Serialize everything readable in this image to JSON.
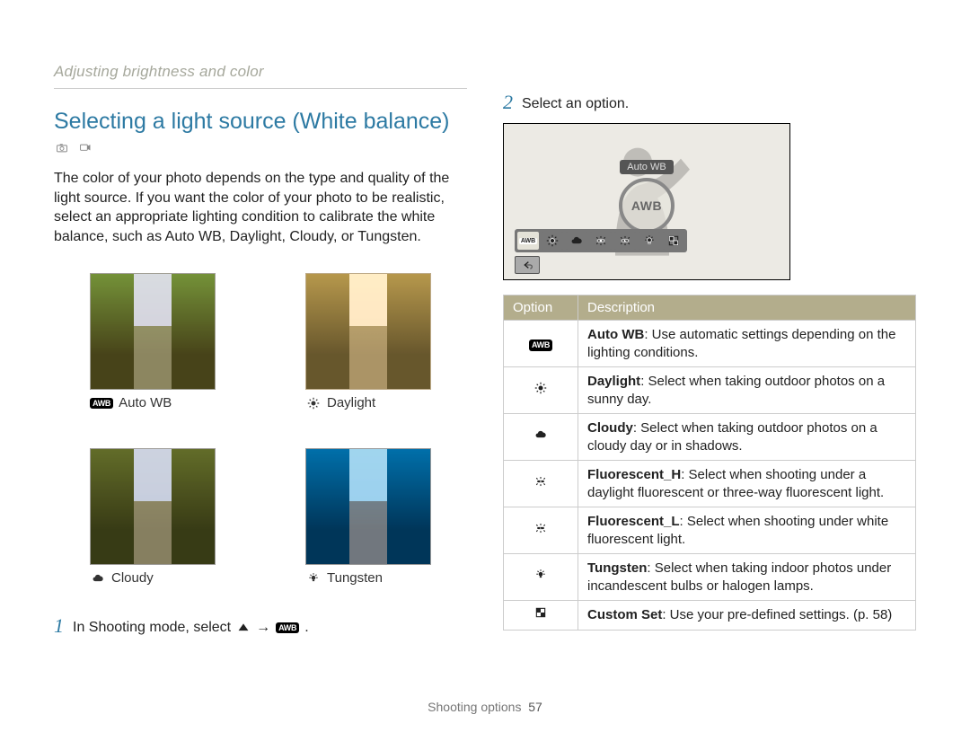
{
  "breadcrumb": "Adjusting brightness and color",
  "heading": "Selecting a light source (White balance)",
  "intro": "The color of your photo depends on the type and quality of the light source. If you want the color of your photo to be realistic, select an appropriate lighting condition to calibrate the white balance, such as Auto WB, Daylight, Cloudy, or Tungsten.",
  "samples": {
    "auto_wb": "Auto WB",
    "daylight": "Daylight",
    "cloudy": "Cloudy",
    "tungsten": "Tungsten"
  },
  "steps": {
    "s1_num": "1",
    "s1_a": "In Shooting mode, select",
    "s1_b": "→",
    "s1_c": ".",
    "s2_num": "2",
    "s2": "Select an option."
  },
  "screen": {
    "label": "Auto WB",
    "ring": "AWB",
    "icons": [
      "awb",
      "daylight",
      "cloudy",
      "fluor_h",
      "fluor_l",
      "tungsten",
      "custom"
    ]
  },
  "table": {
    "h_option": "Option",
    "h_desc": "Description",
    "rows": [
      {
        "icon": "awb",
        "name": "Auto WB",
        "desc": ": Use automatic settings depending on the lighting conditions."
      },
      {
        "icon": "daylight",
        "name": "Daylight",
        "desc": ": Select when taking outdoor photos on a sunny day."
      },
      {
        "icon": "cloudy",
        "name": "Cloudy",
        "desc": ": Select when taking outdoor photos on a cloudy day or in shadows."
      },
      {
        "icon": "fluor_h",
        "name": "Fluorescent_H",
        "desc": ": Select when shooting under a daylight fluorescent or three-way fluorescent light."
      },
      {
        "icon": "fluor_l",
        "name": "Fluorescent_L",
        "desc": ": Select when shooting under white fluorescent light."
      },
      {
        "icon": "tungsten",
        "name": "Tungsten",
        "desc": ": Select when taking indoor photos under incandescent bulbs or halogen lamps."
      },
      {
        "icon": "custom",
        "name": "Custom Set",
        "desc": ": Use your pre-defined settings. (p. 58)"
      }
    ]
  },
  "footer": {
    "section": "Shooting options",
    "page": "57"
  }
}
